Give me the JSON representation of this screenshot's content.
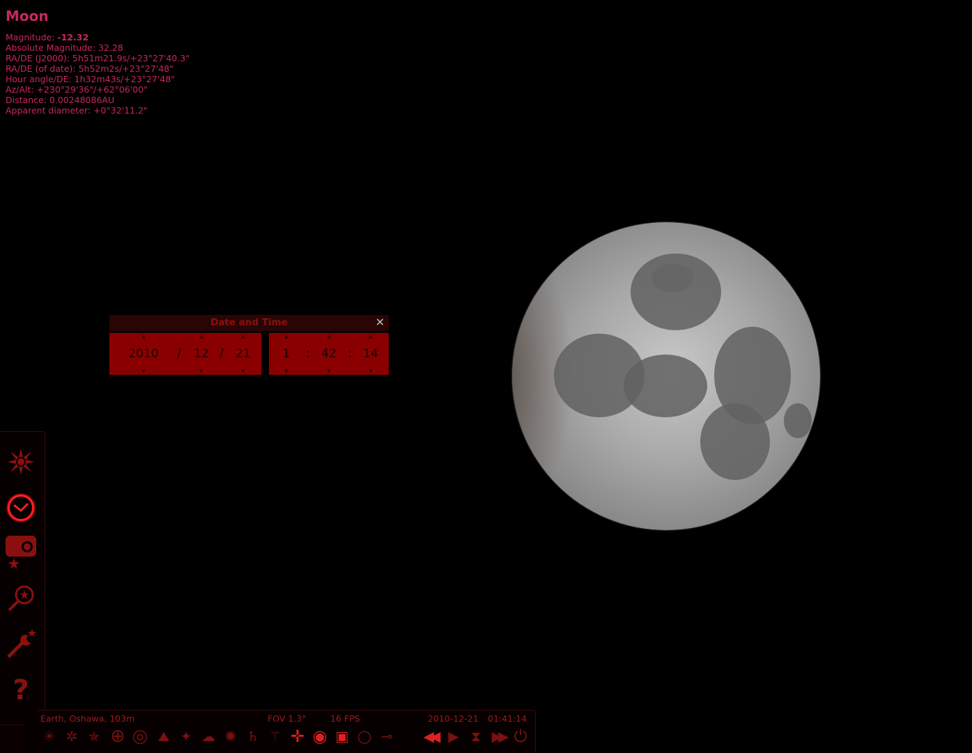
{
  "object_info": {
    "title": "Moon",
    "magnitude_label": "Magnitude: ",
    "magnitude_value": "-12.32",
    "absolute_magnitude": "Absolute Magnitude: 32.28",
    "ra_de_j2000": "RA/DE (J2000): 5h51m21.9s/+23°27'40.3\"",
    "ra_de_of_date": "RA/DE (of date): 5h52m2s/+23°27'48\"",
    "hour_angle": "Hour angle/DE: 1h32m43s/+23°27'48\"",
    "az_alt": "Az/Alt: +230°29'36\"/+62°06'00\"",
    "distance": "Distance: 0.00248086AU",
    "apparent_diameter": "Apparent diameter: +0°32'11.2\""
  },
  "date_time_dialog": {
    "title": "Date and Time",
    "close_icon": "close-icon",
    "year": "2010",
    "month": "12",
    "day": "21",
    "hour": "1",
    "minute": "42",
    "second": "14",
    "date_sep": "/",
    "time_sep": ":",
    "up_arrow": "▲",
    "down_arrow": "▼"
  },
  "left_toolbar": {
    "items": [
      {
        "name": "sky-and-viewing-options-icon",
        "glyph": "✸"
      },
      {
        "name": "date-time-icon",
        "glyph": "◷"
      },
      {
        "name": "location-icon",
        "glyph": "✦"
      },
      {
        "name": "search-icon",
        "glyph": "⚲"
      },
      {
        "name": "configuration-icon",
        "glyph": "🔧"
      },
      {
        "name": "help-icon",
        "glyph": "?"
      }
    ]
  },
  "status_bar": {
    "location": "Earth, Oshawa, 103m",
    "fov": "FOV 1.3°",
    "fps": "16 FPS",
    "date": "2010-12-21",
    "time": "01:41:14"
  },
  "bottom_toolbar": {
    "items": [
      {
        "name": "constellation-lines-icon",
        "glyph": "✳"
      },
      {
        "name": "constellation-labels-icon",
        "glyph": "✲"
      },
      {
        "name": "constellation-art-icon",
        "glyph": "✯"
      },
      {
        "name": "equatorial-grid-icon",
        "glyph": "⊕"
      },
      {
        "name": "azimuthal-grid-icon",
        "glyph": "◎"
      },
      {
        "name": "ground-icon",
        "glyph": "⛰"
      },
      {
        "name": "cardinal-points-icon",
        "glyph": "✦"
      },
      {
        "name": "atmosphere-icon",
        "glyph": "☁"
      },
      {
        "name": "nebulae-icon",
        "glyph": "✺"
      },
      {
        "name": "planet-labels-icon",
        "glyph": "♄"
      },
      {
        "name": "equatorial-mount-icon",
        "glyph": "⚚"
      },
      {
        "name": "center-on-object-icon",
        "glyph": "✛"
      },
      {
        "name": "night-mode-icon",
        "glyph": "◉"
      },
      {
        "name": "full-screen-icon",
        "glyph": "▣"
      },
      {
        "name": "ocular-icon",
        "glyph": "○"
      },
      {
        "name": "satellites-icon",
        "glyph": "⊸"
      },
      {
        "name": "decrease-time-speed-icon",
        "glyph": "◀◀"
      },
      {
        "name": "real-time-speed-icon",
        "glyph": "▶"
      },
      {
        "name": "current-time-icon",
        "glyph": "⧗"
      },
      {
        "name": "increase-time-speed-icon",
        "glyph": "▶▶"
      },
      {
        "name": "quit-icon",
        "glyph": "⏻"
      }
    ]
  },
  "colors": {
    "info_text": "#c8285a",
    "dialog_bg": "#8a0000",
    "toolbar_icon": "#7a1010",
    "toolbar_icon_active": "#e02020"
  }
}
